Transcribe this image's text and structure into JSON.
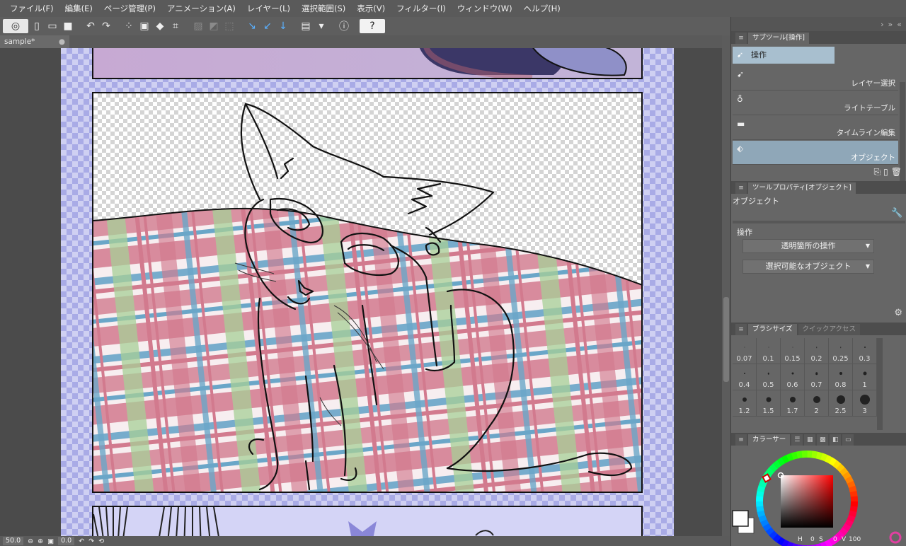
{
  "menu": [
    "ファイル(F)",
    "編集(E)",
    "ページ管理(P)",
    "アニメーション(A)",
    "レイヤー(L)",
    "選択範囲(S)",
    "表示(V)",
    "フィルター(I)",
    "ウィンドウ(W)",
    "ヘルプ(H)"
  ],
  "document": {
    "tab_title": "sample*",
    "tab_close": "●"
  },
  "statusbar": {
    "zoom": "50.0",
    "rotation": "0.0"
  },
  "subtool_palette": {
    "tab_label": "サブツール[操作]",
    "selected_tool": "操作",
    "items": [
      {
        "label": "レイヤー選択",
        "icon": "layer-select-icon"
      },
      {
        "label": "ライトテーブル",
        "icon": "light-table-icon"
      },
      {
        "label": "タイムライン編集",
        "icon": "timeline-edit-icon"
      },
      {
        "label": "オブジェクト",
        "icon": "object-icon"
      }
    ]
  },
  "tool_property": {
    "tab_label": "ツールプロパティ[オブジェクト]",
    "title": "オブジェクト",
    "group_label": "操作",
    "select1": "透明箇所の操作",
    "select2": "選択可能なオブジェクト"
  },
  "brush_size": {
    "tab_label": "ブラシサイズ",
    "tab_inactive": "クイックアクセス",
    "sizes": [
      "0.07",
      "0.1",
      "0.15",
      "0.2",
      "0.25",
      "0.3",
      "0.4",
      "0.5",
      "0.6",
      "0.7",
      "0.8",
      "1",
      "1.2",
      "1.5",
      "1.7",
      "2",
      "2.5",
      "3"
    ]
  },
  "color_palette": {
    "tab_label": "カラーサー",
    "h_value": "0",
    "s_value": "0",
    "v_value": "100",
    "main_color": "#ffffff",
    "sub_color": "#ffffff"
  },
  "colors": {
    "accent": "#a8bfcf",
    "plaid_pink": "#d27a8e",
    "plaid_blue": "#6aa6c8",
    "plaid_green": "#a6cf96",
    "page_bg": "#cfd0f2"
  }
}
